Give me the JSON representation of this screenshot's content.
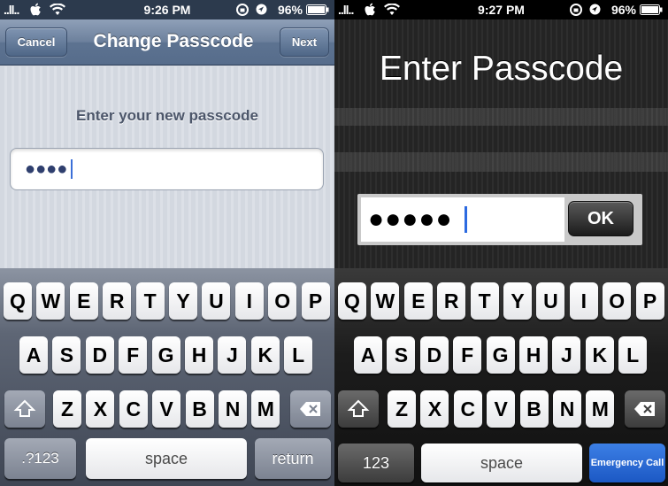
{
  "left": {
    "status": {
      "carrier": "..ll..",
      "time": "9:26 PM",
      "battery": "96%"
    },
    "nav": {
      "cancel_label": "Cancel",
      "title": "Change Passcode",
      "next_label": "Next"
    },
    "prompt": "Enter your new passcode",
    "passcode_dots": "●●●●",
    "keyboard": {
      "row1": [
        "Q",
        "W",
        "E",
        "R",
        "T",
        "Y",
        "U",
        "I",
        "O",
        "P"
      ],
      "row2": [
        "A",
        "S",
        "D",
        "F",
        "G",
        "H",
        "J",
        "K",
        "L"
      ],
      "row3": [
        "Z",
        "X",
        "C",
        "V",
        "B",
        "N",
        "M"
      ],
      "numbers_label": ".?123",
      "space_label": "space",
      "return_label": "return"
    }
  },
  "right": {
    "status": {
      "carrier": "..ll..",
      "time": "9:27 PM",
      "battery": "96%"
    },
    "title": "Enter Passcode",
    "passcode_dots": "●●●●●",
    "ok_label": "OK",
    "keyboard": {
      "row1": [
        "Q",
        "W",
        "E",
        "R",
        "T",
        "Y",
        "U",
        "I",
        "O",
        "P"
      ],
      "row2": [
        "A",
        "S",
        "D",
        "F",
        "G",
        "H",
        "J",
        "K",
        "L"
      ],
      "row3": [
        "Z",
        "X",
        "C",
        "V",
        "B",
        "N",
        "M"
      ],
      "numbers_label": "123",
      "space_label": "space",
      "emergency_label": "Emergency Call"
    }
  },
  "icons": {
    "apple": "apple-logo-icon",
    "wifi": "wifi-icon",
    "lock_rotation": "rotation-lock-icon",
    "location": "location-icon",
    "battery": "battery-icon",
    "shift": "shift-icon",
    "delete": "delete-icon"
  },
  "colors": {
    "nav_blue": "#5d7391",
    "cursor_blue": "#3b6fd8",
    "emergency_blue": "#1c58c4"
  }
}
